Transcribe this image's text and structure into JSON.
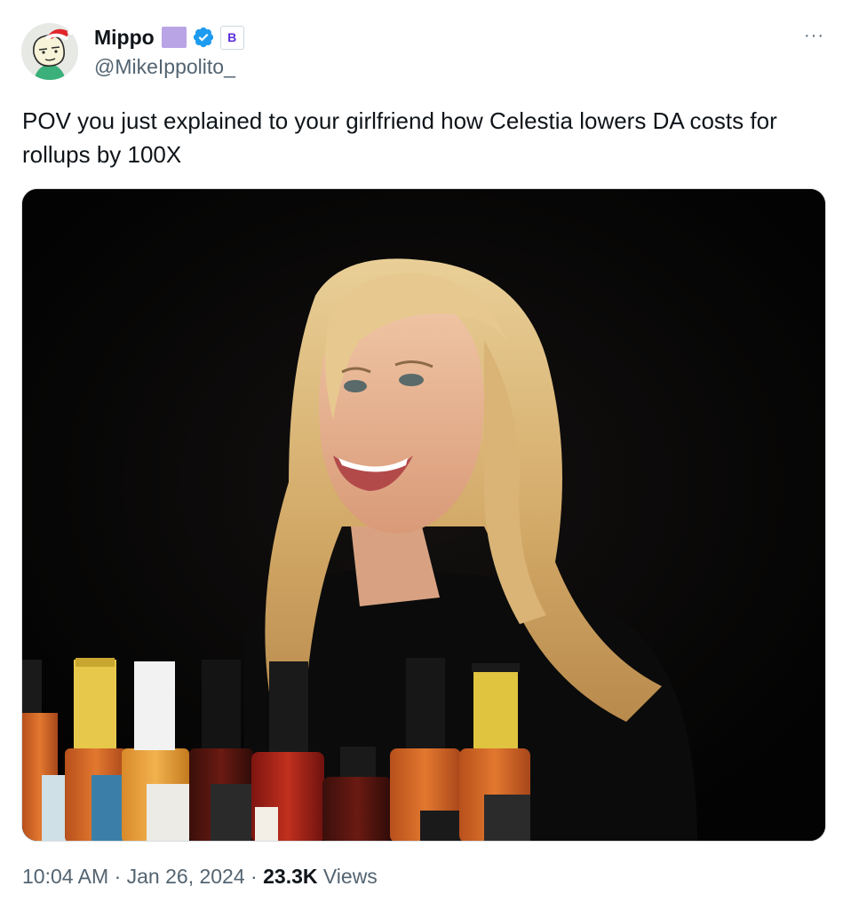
{
  "author": {
    "display_name": "Mippo",
    "handle": "@MikeIppolito_",
    "avatar_icon": "cartoon-face-santa-hat-avatar",
    "badges": [
      "purple-square-emoji",
      "verified-icon",
      "b-affiliate-badge"
    ],
    "badge_b_letter": "B",
    "verified_color": "#1d9bf0"
  },
  "tweet": {
    "text": "POV you just explained to your girlfriend how Celestia lowers DA costs for rollups by 100X",
    "more_label": "···"
  },
  "media": {
    "icon": "photo-woman-smiling-hot-sauce-bottles"
  },
  "meta": {
    "time": "10:04 AM",
    "separator": "·",
    "date": "Jan 26, 2024",
    "views_count": "23.3K",
    "views_label": "Views"
  }
}
